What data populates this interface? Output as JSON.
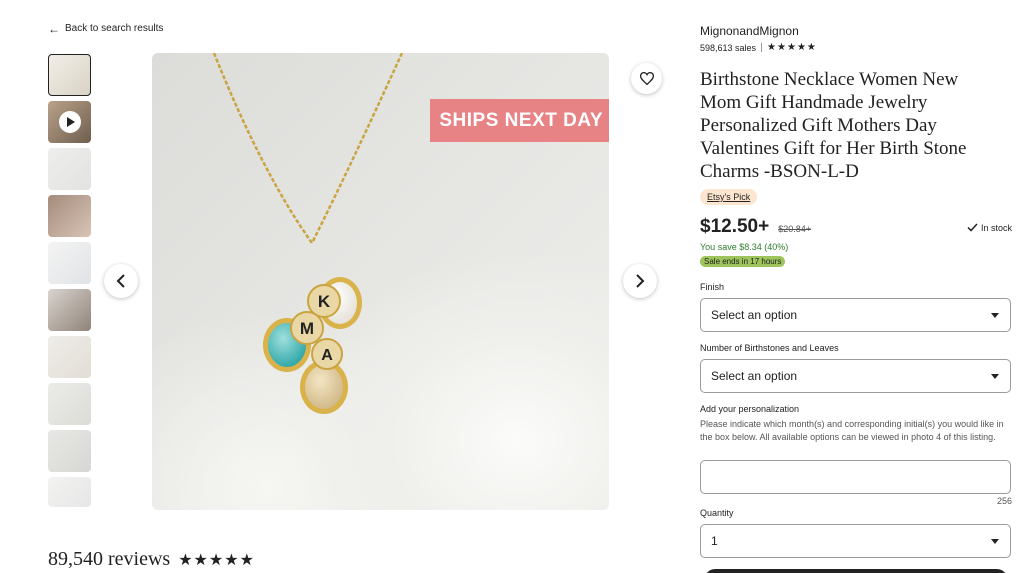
{
  "nav": {
    "back_label": "Back to search results"
  },
  "gallery": {
    "thumbnails": [
      {
        "name": "thumb-1",
        "colors": [
          "#f2eee8",
          "#d9d3c4"
        ]
      },
      {
        "name": "thumb-video",
        "colors": [
          "#b9a28a",
          "#6f5e4e"
        ]
      },
      {
        "name": "thumb-3",
        "colors": [
          "#eeeeed",
          "#e2e2df"
        ]
      },
      {
        "name": "thumb-4",
        "colors": [
          "#a48b7c",
          "#d8c4b6"
        ]
      },
      {
        "name": "thumb-5",
        "colors": [
          "#f4f4f3",
          "#e0e3e6"
        ]
      },
      {
        "name": "thumb-6",
        "colors": [
          "#d9d4cf",
          "#8f8378"
        ]
      },
      {
        "name": "thumb-7",
        "colors": [
          "#efedea",
          "#e2ddd5"
        ]
      },
      {
        "name": "thumb-8",
        "colors": [
          "#ebebe8",
          "#dcdcd7"
        ]
      },
      {
        "name": "thumb-9",
        "colors": [
          "#e8e8e6",
          "#d6d6d2"
        ]
      },
      {
        "name": "thumb-10",
        "colors": [
          "#f3f3f1",
          "#e5e7e6"
        ]
      }
    ],
    "banner": "SHIPS NEXT DAY",
    "charm_letters": [
      "K",
      "M",
      "A"
    ]
  },
  "reviews": {
    "count_label": "89,540 reviews",
    "stars": "★★★★★"
  },
  "shop": {
    "name": "MignonandMignon",
    "sales": "598,613 sales",
    "stars": "★★★★★"
  },
  "listing": {
    "title": "Birthstone Necklace Women New Mom Gift Handmade Jewelry Personalized Gift Mothers Day Valentines Gift for Her Birth Stone Charms -BSON-L-D",
    "badge": "Etsy's Pick",
    "price": "$12.50+",
    "original_price": "$20.84+",
    "stock": "In stock",
    "savings": "You save $8.34 (40%)",
    "sale_badge": "Sale ends in 17 hours"
  },
  "options": {
    "finish_label": "Finish",
    "finish_value": "Select an option",
    "birthstones_label": "Number of Birthstones and Leaves",
    "birthstones_value": "Select an option",
    "personalization_label": "Add your personalization",
    "personalization_help": "Please indicate which month(s) and corresponding initial(s) you would like in the box below. All available options can be viewed in photo 4 of this listing.",
    "char_count": "256",
    "quantity_label": "Quantity",
    "quantity_value": "1"
  },
  "colors": {
    "banner": "#e78285",
    "sale_badge": "#9ec55c",
    "savings_text": "#2d7d2d",
    "pick_badge": "#fde6cf"
  }
}
